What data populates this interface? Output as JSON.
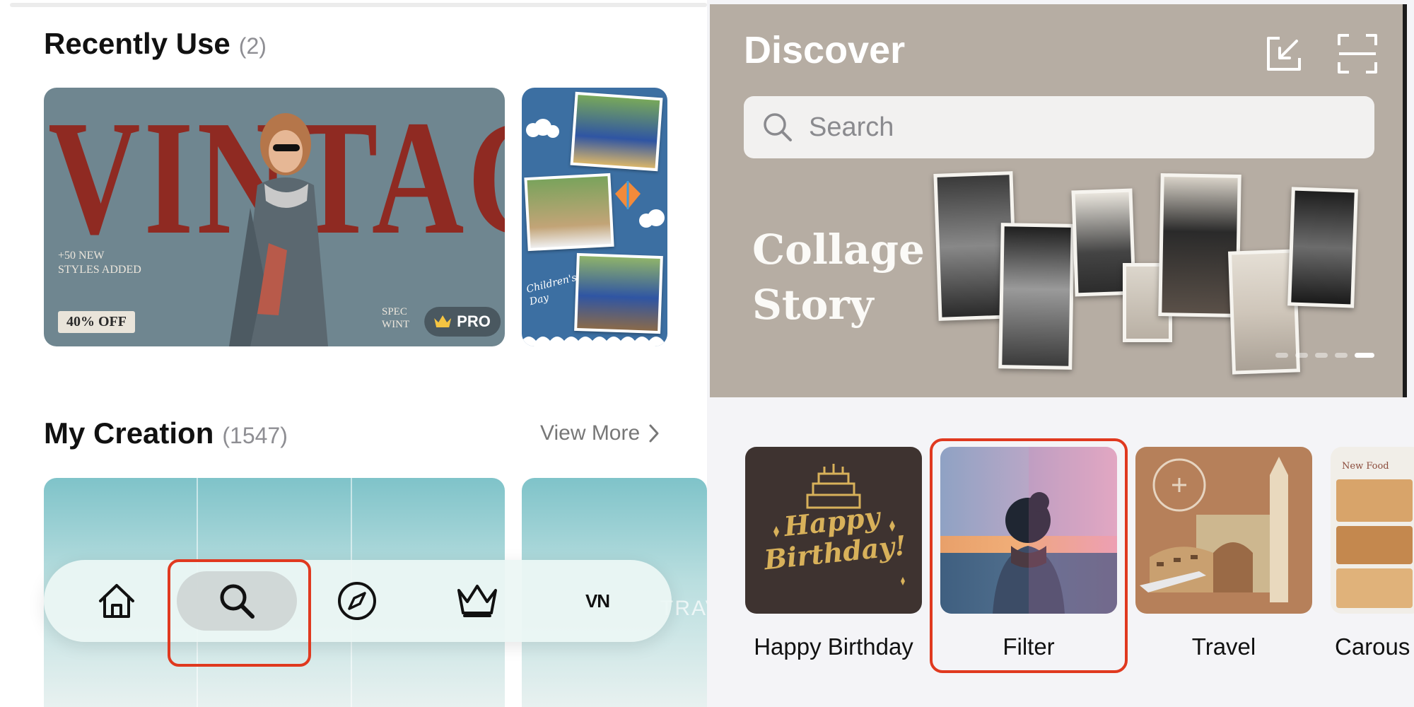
{
  "recently_use": {
    "title": "Recently Use",
    "count": "(2)",
    "templates": [
      {
        "big_text": "VINTAG",
        "small_text": "+50 NEW\nSTYLES ADDED",
        "badge_left": "40% OFF",
        "corner_text": "SPEC\nWINT",
        "pro_label": "PRO"
      },
      {
        "caption": "Children's\nDay"
      }
    ]
  },
  "my_creation": {
    "title": "My Creation",
    "count": "(1547)",
    "view_more": "View More",
    "thumbnail_text": "TRAV"
  },
  "bottom_nav": {
    "items": [
      {
        "icon": "home-icon",
        "active": false
      },
      {
        "icon": "search-icon",
        "active": true
      },
      {
        "icon": "compass-icon",
        "active": false
      },
      {
        "icon": "crown-icon",
        "active": false
      },
      {
        "icon": "vn-logo",
        "label": "VN",
        "active": false
      }
    ]
  },
  "discover": {
    "title": "Discover",
    "icons": [
      "import-icon",
      "scan-icon"
    ],
    "search_placeholder": "Search",
    "banner": {
      "title": "Collage\nStory",
      "carousel_pages": 5,
      "active_page": 5
    },
    "categories": [
      {
        "label": "Happy Birthday",
        "art_text": "Happy\nBirthday!"
      },
      {
        "label": "Filter"
      },
      {
        "label": "Travel"
      },
      {
        "label": "Carous",
        "art_text": "New Food"
      }
    ]
  },
  "colors": {
    "highlight": "#e0391f",
    "hero_background": "#b6ada3",
    "vintage_red": "#8f2a22"
  }
}
